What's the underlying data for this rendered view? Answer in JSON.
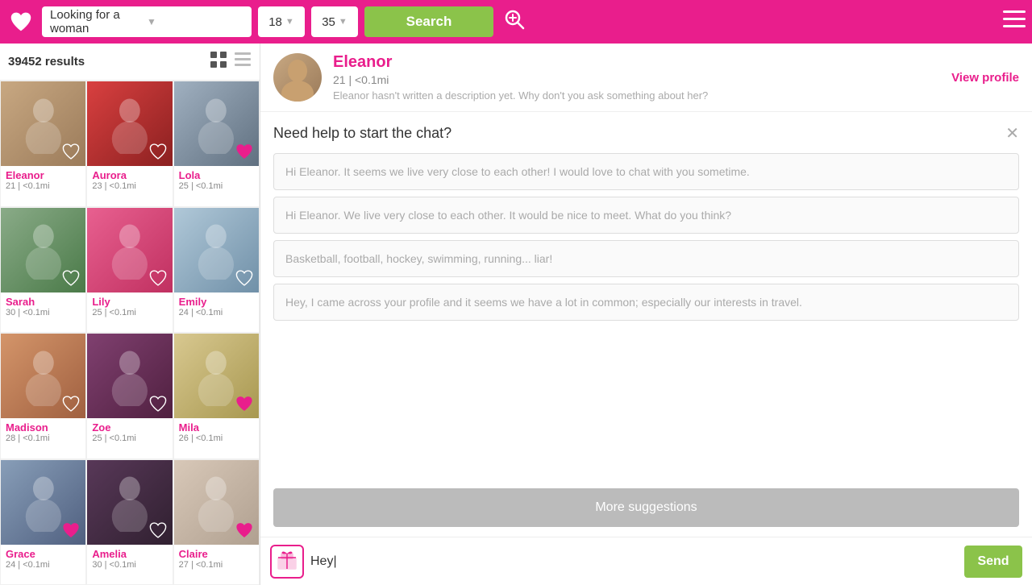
{
  "nav": {
    "search_placeholder": "Looking for a woman",
    "age_min": "18",
    "age_max": "35",
    "search_label": "Search",
    "menu_icon": "≡"
  },
  "results": {
    "count": "39452 results"
  },
  "profiles": [
    {
      "id": "eleanor",
      "name": "Eleanor",
      "age": "21",
      "dist": "<0.1mi",
      "color": "card-eleanor",
      "heart": "outline"
    },
    {
      "id": "aurora",
      "name": "Aurora",
      "age": "23",
      "dist": "<0.1mi",
      "color": "card-aurora",
      "heart": "outline"
    },
    {
      "id": "lola",
      "name": "Lola",
      "age": "25",
      "dist": "<0.1mi",
      "color": "card-lola",
      "heart": "pink"
    },
    {
      "id": "sarah",
      "name": "Sarah",
      "age": "30",
      "dist": "<0.1mi",
      "color": "card-sarah",
      "heart": "outline"
    },
    {
      "id": "lily",
      "name": "Lily",
      "age": "25",
      "dist": "<0.1mi",
      "color": "card-lily",
      "heart": "outline"
    },
    {
      "id": "emily",
      "name": "Emily",
      "age": "24",
      "dist": "<0.1mi",
      "color": "card-emily",
      "heart": "outline"
    },
    {
      "id": "madison",
      "name": "Madison",
      "age": "28",
      "dist": "<0.1mi",
      "color": "card-madison",
      "heart": "outline"
    },
    {
      "id": "zoe",
      "name": "Zoe",
      "age": "25",
      "dist": "<0.1mi",
      "color": "card-zoe",
      "heart": "outline"
    },
    {
      "id": "mila",
      "name": "Mila",
      "age": "26",
      "dist": "<0.1mi",
      "color": "card-mila",
      "heart": "pink"
    },
    {
      "id": "grace",
      "name": "Grace",
      "age": "24",
      "dist": "<0.1mi",
      "color": "card-grace",
      "heart": "pink"
    },
    {
      "id": "amelia",
      "name": "Amelia",
      "age": "30",
      "dist": "<0.1mi",
      "color": "card-amelia",
      "heart": "outline"
    },
    {
      "id": "claire",
      "name": "Claire",
      "age": "27",
      "dist": "<0.1mi",
      "color": "card-claire",
      "heart": "pink"
    }
  ],
  "active_profile": {
    "name": "Eleanor",
    "age": "21",
    "dist": "<0.1mi",
    "bio": "Eleanor hasn't written a description yet. Why don't you ask something about her?",
    "view_profile_label": "View profile"
  },
  "chat": {
    "help_title": "Need help to start the chat?",
    "suggestions": [
      "Hi Eleanor. It seems we live very close to each other! I would love to chat with you sometime.",
      "Hi Eleanor. We live very close to each other. It would be nice to meet. What do you think?",
      "Basketball, football, hockey, swimming, running... liar!",
      "Hey, I came across your profile and it seems we have a lot in common; especially our interests in travel."
    ],
    "more_suggestions_label": "More suggestions",
    "message_value": "Hey|",
    "send_label": "Send"
  }
}
